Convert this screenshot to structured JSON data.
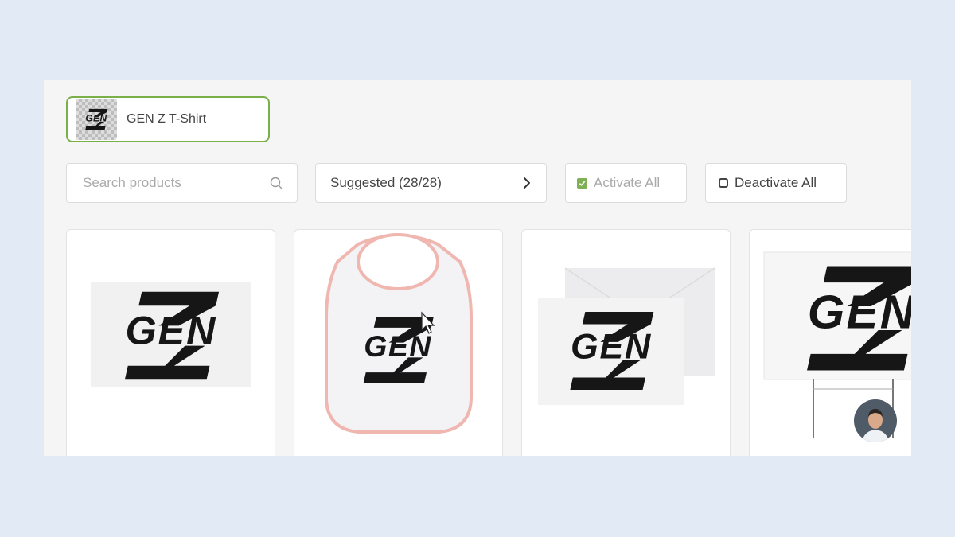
{
  "design": {
    "name": "GEN Z T-Shirt",
    "thumbnail_logo": "gen-z-logo"
  },
  "search": {
    "placeholder": "Search products",
    "icon": "search-icon"
  },
  "filter": {
    "label": "Suggested (28/28)",
    "icon": "chevron-right-icon"
  },
  "actions": {
    "activate_all": "Activate All",
    "deactivate_all": "Deactivate All"
  },
  "products": [
    {
      "item": "sticker",
      "logo": "gen-z-logo"
    },
    {
      "item": "baby-bib",
      "logo": "gen-z-logo"
    },
    {
      "item": "greeting-card",
      "logo": "gen-z-logo"
    },
    {
      "item": "yard-sign",
      "logo": "gen-z-logo"
    }
  ],
  "colors": {
    "selected_border": "#79b04a",
    "check_green": "#7fb055",
    "background": "#e2ebf5"
  }
}
